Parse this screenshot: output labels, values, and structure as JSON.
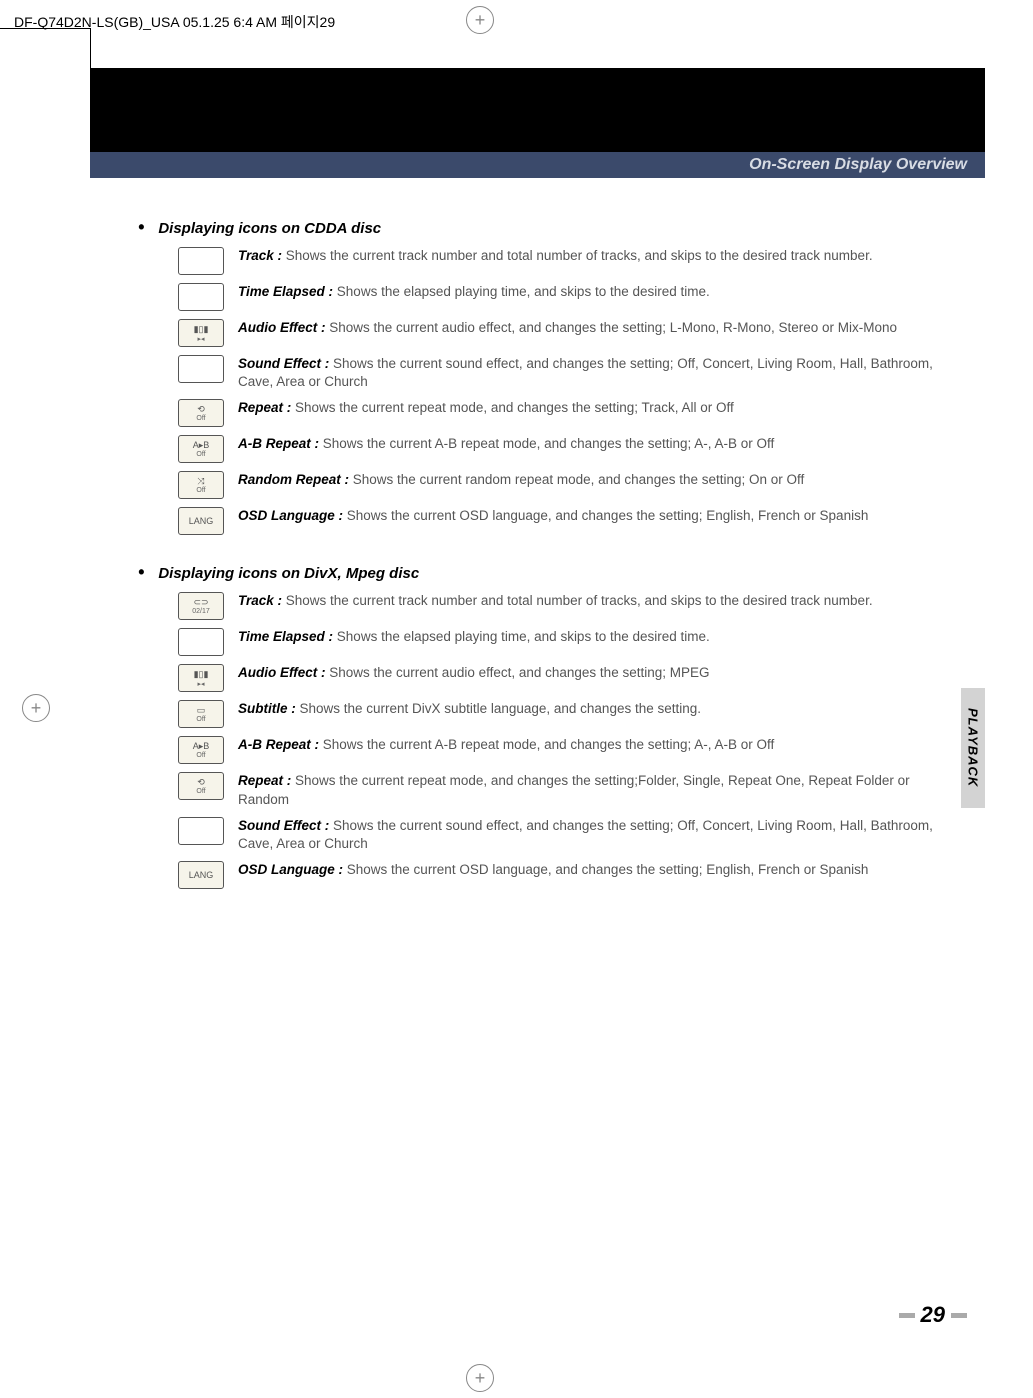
{
  "header_line": "DF-Q74D2N-LS(GB)_USA  05.1.25 6:4 AM  페이지29",
  "banner_title": "On-Screen Display Overview",
  "side_tab": "PLAYBACK",
  "page_number": "29",
  "sections": [
    {
      "heading": "Displaying icons on CDDA disc",
      "items": [
        {
          "icon": "blank",
          "label": "Track :",
          "text": "  Shows the current track number and total number of tracks, and skips to the desired track number."
        },
        {
          "icon": "blank",
          "label": "Time Elapsed  :",
          "text": "  Shows the elapsed playing time, and skips to the desired time."
        },
        {
          "icon": "audio",
          "label": "Audio Effect :",
          "text": "  Shows the current audio effect, and changes the setting; L-Mono, R-Mono, Stereo or Mix-Mono"
        },
        {
          "icon": "blank",
          "label": "Sound Effect :",
          "text": "  Shows the current sound effect, and changes the setting; Off, Concert, Living Room, Hall, Bathroom, Cave, Area or Church"
        },
        {
          "icon": "repeat",
          "label": "Repeat :",
          "text": "  Shows the current repeat mode, and changes the setting; Track, All or Off"
        },
        {
          "icon": "ab",
          "label": "A-B Repeat :",
          "text": "  Shows the current A-B repeat mode, and changes the setting; A-, A-B or Off"
        },
        {
          "icon": "random",
          "label": "Random Repeat :",
          "text": "  Shows the current random repeat mode, and changes the setting; On or Off"
        },
        {
          "icon": "lang",
          "label": "OSD Language :",
          "text": "  Shows the current OSD language, and changes the setting; English, French or Spanish"
        }
      ]
    },
    {
      "heading": "Displaying icons on DivX, Mpeg disc",
      "items": [
        {
          "icon": "track",
          "label": "Track :",
          "text": "  Shows the current track number and total number of tracks, and skips to the desired track number."
        },
        {
          "icon": "blank",
          "label": "Time Elapsed  :",
          "text": "  Shows the elapsed playing time, and skips to the desired time."
        },
        {
          "icon": "audio",
          "label": "Audio Effect :",
          "text": "  Shows the current audio effect, and changes the setting; MPEG"
        },
        {
          "icon": "subtitle",
          "label": "Subtitle :",
          "text": "  Shows the current DivX subtitle language, and changes the setting."
        },
        {
          "icon": "ab",
          "label": "A-B Repeat :",
          "text": "  Shows the current A-B repeat mode, and changes the setting; A-, A-B or Off"
        },
        {
          "icon": "repeat",
          "label": "Repeat :",
          "text": "  Shows the current repeat mode, and changes the setting;Folder, Single, Repeat One, Repeat Folder or Random"
        },
        {
          "icon": "blank",
          "label": "Sound Effect :",
          "text": "  Shows the current sound effect, and changes the setting; Off, Concert, Living Room, Hall, Bathroom, Cave, Area or Church"
        },
        {
          "icon": "lang",
          "label": "OSD Language :",
          "text": "  Shows the current OSD language, and changes the setting; English, French or Spanish"
        }
      ]
    }
  ],
  "icons": {
    "blank": {
      "top": "",
      "bottom": ""
    },
    "audio": {
      "top": "▮▯▮",
      "bottom": "▸◂"
    },
    "repeat": {
      "top": "⟲",
      "bottom": "Off"
    },
    "ab": {
      "top": "A▸B",
      "bottom": "Off"
    },
    "random": {
      "top": "⤨",
      "bottom": "Off"
    },
    "lang": {
      "top": "LANG",
      "bottom": ""
    },
    "track": {
      "top": "⊂⊃",
      "bottom": "02/17"
    },
    "subtitle": {
      "top": "▭",
      "bottom": "Off"
    }
  }
}
